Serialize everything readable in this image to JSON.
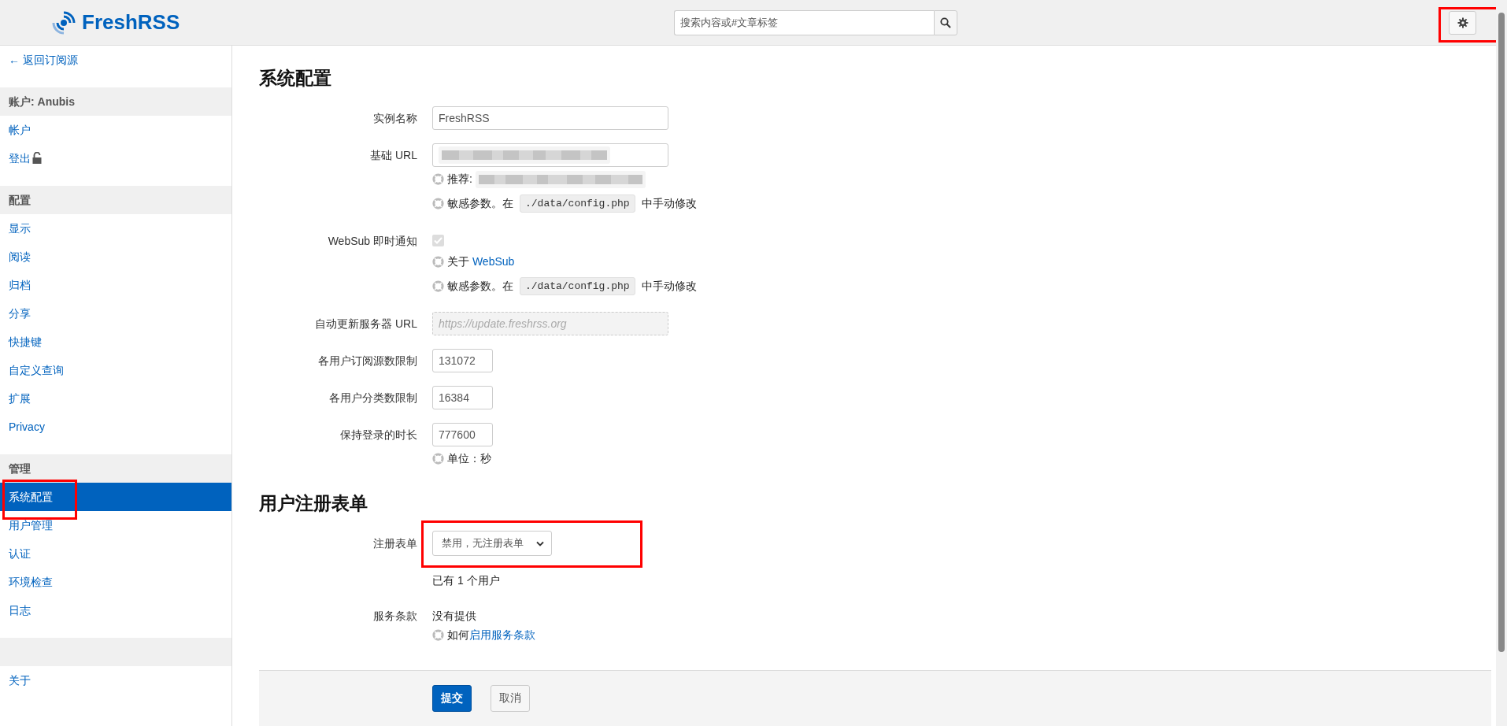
{
  "header": {
    "logo": "FreshRSS",
    "search": {
      "placeholder": "搜索内容或#文章标签"
    },
    "settings_button": {
      "highlighted": true
    }
  },
  "sidebar": {
    "back_link": "← 返回订阅源",
    "groups": [
      {
        "title": "账户: Anubis",
        "items": [
          {
            "label": "帐户",
            "selected": false
          },
          {
            "label": "登出",
            "selected": false,
            "kind": "logout"
          }
        ]
      },
      {
        "title": "配置",
        "items": [
          {
            "label": "显示",
            "selected": false
          },
          {
            "label": "阅读",
            "selected": false
          },
          {
            "label": "归档",
            "selected": false
          },
          {
            "label": "分享",
            "selected": false
          },
          {
            "label": "快捷键",
            "selected": false
          },
          {
            "label": "自定义查询",
            "selected": false
          },
          {
            "label": "扩展",
            "selected": false
          },
          {
            "label": "Privacy",
            "selected": false
          }
        ]
      },
      {
        "title": "管理",
        "items": [
          {
            "label": "系统配置",
            "selected": true,
            "highlighted": true
          },
          {
            "label": "用户管理",
            "selected": false
          },
          {
            "label": "认证",
            "selected": false
          },
          {
            "label": "环境检查",
            "selected": false
          },
          {
            "label": "日志",
            "selected": false
          }
        ]
      },
      {
        "items": [
          {
            "label": "关于",
            "selected": false
          }
        ]
      }
    ]
  },
  "main": {
    "sections": [
      {
        "title": "系统配置",
        "fields": [
          {
            "kind": "text",
            "label": "实例名称",
            "value": "FreshRSS"
          },
          {
            "kind": "redacted",
            "label": "基础 URL",
            "hints": [
              {
                "kind": "redacted",
                "text": "推荐:"
              },
              {
                "kind": "code",
                "text": "敏感参数。在",
                "code": "./data/config.php",
                "after": "中手动修改"
              }
            ]
          },
          {
            "kind": "checkbox",
            "label": "WebSub 即时通知",
            "checked": true,
            "disabled": true,
            "hints": [
              {
                "kind": "link",
                "text": "关于 ",
                "link": "WebSub"
              },
              {
                "kind": "code",
                "text": "敏感参数。在",
                "code": "./data/config.php",
                "after": "中手动修改"
              }
            ]
          },
          {
            "kind": "text",
            "label": "自动更新服务器 URL",
            "placeholder": "https://update.freshrss.org",
            "disabled": true
          },
          {
            "kind": "number",
            "label": "各用户订阅源数限制",
            "value": "131072"
          },
          {
            "kind": "number",
            "label": "各用户分类数限制",
            "value": "16384"
          },
          {
            "kind": "number",
            "label": "保持登录的时长",
            "value": "777600",
            "hints": [
              {
                "kind": "plain",
                "text": "单位：秒"
              }
            ]
          }
        ]
      },
      {
        "title": "用户注册表单",
        "fields": [
          {
            "kind": "select",
            "label": "注册表单",
            "value": "禁用，无注册表单",
            "highlighted": true,
            "hints": [
              {
                "kind": "note",
                "text": "已有 1 个用户"
              }
            ]
          },
          {
            "kind": "static",
            "label": "服务条款",
            "value": "没有提供",
            "hints": [
              {
                "kind": "link",
                "text": "如何",
                "link": "启用服务条款"
              }
            ]
          }
        ]
      }
    ],
    "buttons": [
      {
        "label": "提交",
        "kind": "primary"
      },
      {
        "label": "取消",
        "kind": "secondary"
      }
    ]
  }
}
